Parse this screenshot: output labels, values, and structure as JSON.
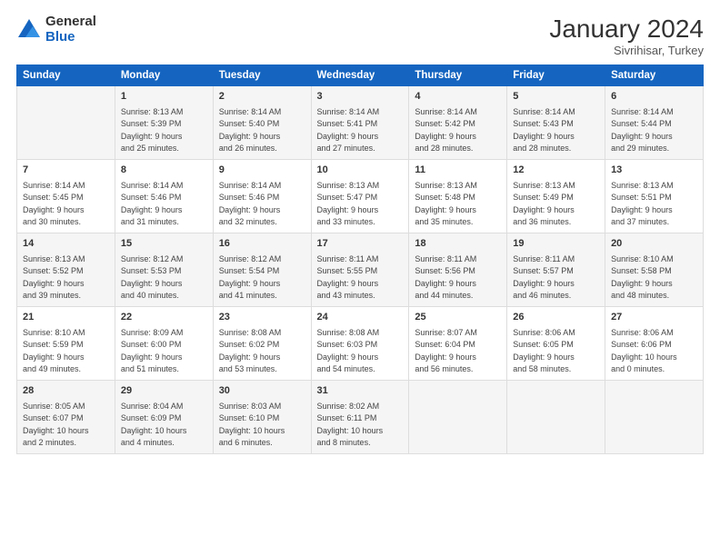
{
  "header": {
    "logo_general": "General",
    "logo_blue": "Blue",
    "month_title": "January 2024",
    "subtitle": "Sivrihisar, Turkey"
  },
  "days_of_week": [
    "Sunday",
    "Monday",
    "Tuesday",
    "Wednesday",
    "Thursday",
    "Friday",
    "Saturday"
  ],
  "weeks": [
    [
      {
        "day": "",
        "info": ""
      },
      {
        "day": "1",
        "info": "Sunrise: 8:13 AM\nSunset: 5:39 PM\nDaylight: 9 hours\nand 25 minutes."
      },
      {
        "day": "2",
        "info": "Sunrise: 8:14 AM\nSunset: 5:40 PM\nDaylight: 9 hours\nand 26 minutes."
      },
      {
        "day": "3",
        "info": "Sunrise: 8:14 AM\nSunset: 5:41 PM\nDaylight: 9 hours\nand 27 minutes."
      },
      {
        "day": "4",
        "info": "Sunrise: 8:14 AM\nSunset: 5:42 PM\nDaylight: 9 hours\nand 28 minutes."
      },
      {
        "day": "5",
        "info": "Sunrise: 8:14 AM\nSunset: 5:43 PM\nDaylight: 9 hours\nand 28 minutes."
      },
      {
        "day": "6",
        "info": "Sunrise: 8:14 AM\nSunset: 5:44 PM\nDaylight: 9 hours\nand 29 minutes."
      }
    ],
    [
      {
        "day": "7",
        "info": "Sunrise: 8:14 AM\nSunset: 5:45 PM\nDaylight: 9 hours\nand 30 minutes."
      },
      {
        "day": "8",
        "info": "Sunrise: 8:14 AM\nSunset: 5:46 PM\nDaylight: 9 hours\nand 31 minutes."
      },
      {
        "day": "9",
        "info": "Sunrise: 8:14 AM\nSunset: 5:46 PM\nDaylight: 9 hours\nand 32 minutes."
      },
      {
        "day": "10",
        "info": "Sunrise: 8:13 AM\nSunset: 5:47 PM\nDaylight: 9 hours\nand 33 minutes."
      },
      {
        "day": "11",
        "info": "Sunrise: 8:13 AM\nSunset: 5:48 PM\nDaylight: 9 hours\nand 35 minutes."
      },
      {
        "day": "12",
        "info": "Sunrise: 8:13 AM\nSunset: 5:49 PM\nDaylight: 9 hours\nand 36 minutes."
      },
      {
        "day": "13",
        "info": "Sunrise: 8:13 AM\nSunset: 5:51 PM\nDaylight: 9 hours\nand 37 minutes."
      }
    ],
    [
      {
        "day": "14",
        "info": "Sunrise: 8:13 AM\nSunset: 5:52 PM\nDaylight: 9 hours\nand 39 minutes."
      },
      {
        "day": "15",
        "info": "Sunrise: 8:12 AM\nSunset: 5:53 PM\nDaylight: 9 hours\nand 40 minutes."
      },
      {
        "day": "16",
        "info": "Sunrise: 8:12 AM\nSunset: 5:54 PM\nDaylight: 9 hours\nand 41 minutes."
      },
      {
        "day": "17",
        "info": "Sunrise: 8:11 AM\nSunset: 5:55 PM\nDaylight: 9 hours\nand 43 minutes."
      },
      {
        "day": "18",
        "info": "Sunrise: 8:11 AM\nSunset: 5:56 PM\nDaylight: 9 hours\nand 44 minutes."
      },
      {
        "day": "19",
        "info": "Sunrise: 8:11 AM\nSunset: 5:57 PM\nDaylight: 9 hours\nand 46 minutes."
      },
      {
        "day": "20",
        "info": "Sunrise: 8:10 AM\nSunset: 5:58 PM\nDaylight: 9 hours\nand 48 minutes."
      }
    ],
    [
      {
        "day": "21",
        "info": "Sunrise: 8:10 AM\nSunset: 5:59 PM\nDaylight: 9 hours\nand 49 minutes."
      },
      {
        "day": "22",
        "info": "Sunrise: 8:09 AM\nSunset: 6:00 PM\nDaylight: 9 hours\nand 51 minutes."
      },
      {
        "day": "23",
        "info": "Sunrise: 8:08 AM\nSunset: 6:02 PM\nDaylight: 9 hours\nand 53 minutes."
      },
      {
        "day": "24",
        "info": "Sunrise: 8:08 AM\nSunset: 6:03 PM\nDaylight: 9 hours\nand 54 minutes."
      },
      {
        "day": "25",
        "info": "Sunrise: 8:07 AM\nSunset: 6:04 PM\nDaylight: 9 hours\nand 56 minutes."
      },
      {
        "day": "26",
        "info": "Sunrise: 8:06 AM\nSunset: 6:05 PM\nDaylight: 9 hours\nand 58 minutes."
      },
      {
        "day": "27",
        "info": "Sunrise: 8:06 AM\nSunset: 6:06 PM\nDaylight: 10 hours\nand 0 minutes."
      }
    ],
    [
      {
        "day": "28",
        "info": "Sunrise: 8:05 AM\nSunset: 6:07 PM\nDaylight: 10 hours\nand 2 minutes."
      },
      {
        "day": "29",
        "info": "Sunrise: 8:04 AM\nSunset: 6:09 PM\nDaylight: 10 hours\nand 4 minutes."
      },
      {
        "day": "30",
        "info": "Sunrise: 8:03 AM\nSunset: 6:10 PM\nDaylight: 10 hours\nand 6 minutes."
      },
      {
        "day": "31",
        "info": "Sunrise: 8:02 AM\nSunset: 6:11 PM\nDaylight: 10 hours\nand 8 minutes."
      },
      {
        "day": "",
        "info": ""
      },
      {
        "day": "",
        "info": ""
      },
      {
        "day": "",
        "info": ""
      }
    ]
  ]
}
